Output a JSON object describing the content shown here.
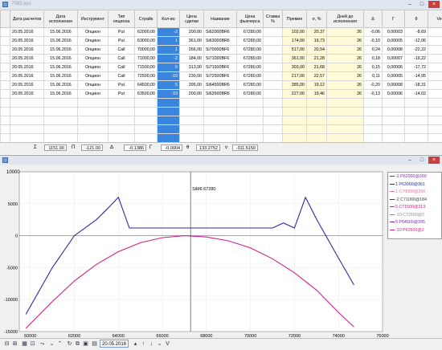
{
  "window_top": {
    "title": "7083.ops"
  },
  "columns": [
    "Дата расчетов",
    "Дата исполнения",
    "Инструмент",
    "Тип опциона",
    "Страйк",
    "Кол-во",
    "Цена сделки",
    "Название",
    "Цена фьючерса",
    "Ставка %",
    "Премия",
    "σ, %",
    "Дней до исполнения",
    "Δ",
    "Γ",
    "θ",
    "Vega"
  ],
  "rows": [
    [
      "20.05.2016",
      "15.06.2016",
      "Опцион",
      "Put",
      "62000,00",
      "-2",
      "200,00",
      "Si62000BR6",
      "67280,00",
      "",
      "102,00",
      "20,37",
      "26",
      "-0,06",
      "0,00003",
      "-8,69",
      "22,20"
    ],
    [
      "20.05.2016",
      "15.06.2016",
      "Опцион",
      "Put",
      "63000,00",
      "1",
      "361,00",
      "Si63000BR6",
      "67280,00",
      "",
      "174,00",
      "19,73",
      "26",
      "-0,10",
      "0,00005",
      "-12,06",
      "31,79"
    ],
    [
      "20.05.2016",
      "15.06.2016",
      "Опцион",
      "Call",
      "70000,00",
      "1",
      "266,00",
      "Si70000BF6",
      "67280,00",
      "",
      "517,00",
      "20,54",
      "26",
      "0,24",
      "0,00008",
      "-22,22",
      "56,25"
    ],
    [
      "20.05.2016",
      "15.06.2016",
      "Опцион",
      "Call",
      "71000,00",
      "-2",
      "184,00",
      "Si71000BF6",
      "67280,00",
      "",
      "361,00",
      "21,28",
      "26",
      "0,18",
      "0,00007",
      "-19,22",
      "46,96"
    ],
    [
      "20.05.2016",
      "15.06.2016",
      "Опцион",
      "Call",
      "71500,00",
      "5",
      "313,00",
      "Si71500BF6",
      "67280,00",
      "",
      "303,00",
      "21,68",
      "26",
      "0,15",
      "0,00006",
      "-17,72",
      "42,48"
    ],
    [
      "20.05.2016",
      "15.06.2016",
      "Опцион",
      "Call",
      "72500,00",
      "-10",
      "230,00",
      "Si72500BF6",
      "67280,00",
      "",
      "217,00",
      "22,57",
      "26",
      "0,11",
      "0,00005",
      "-14,95",
      "34,44"
    ],
    [
      "20.05.2016",
      "15.06.2016",
      "Опцион",
      "Put",
      "64500,00",
      "5",
      "395,00",
      "Si64500BR6",
      "67280,00",
      "",
      "385,00",
      "19,12",
      "26",
      "-0,20",
      "0,00008",
      "-18,31",
      "49,81"
    ],
    [
      "20.05.2016",
      "15.06.2016",
      "Опцион",
      "Put",
      "63500,00",
      "-10",
      "200,00",
      "Si63500BR6",
      "67280,00",
      "",
      "227,00",
      "19,46",
      "26",
      "-0,13",
      "0,00006",
      "-14,02",
      "37,45"
    ]
  ],
  "status": {
    "sigma_sym": "Σ",
    "sigma_val": "1151.00",
    "pi_sym": "Π",
    "pi_val": "-121.00",
    "delta_sym": "Δ",
    "delta_val": "-0.1386",
    "gamma_sym": "Γ",
    "gamma_val": "-0.0004",
    "theta_sym": "θ",
    "theta_val": "133.2752",
    "vega_sym": "ν",
    "vega_val": "-311.5150"
  },
  "chart_data": {
    "type": "line",
    "x_ticks": [
      "60000",
      "62000",
      "64000",
      "66000",
      "68000",
      "70000",
      "72000",
      "74000",
      "76000"
    ],
    "y_ticks": [
      "5000",
      "0",
      "-5000",
      "-10000",
      "-15000"
    ],
    "y_top_label": "10000",
    "xlim": [
      59500,
      76000
    ],
    "ylim": [
      -15000,
      10000
    ],
    "cursor_label": "SiM6 67280",
    "cursor_x": 67280,
    "series": [
      {
        "name": "expiration",
        "color": "#2a2aa0",
        "x": [
          59800,
          61000,
          62000,
          63000,
          63500,
          64000,
          64500,
          66000,
          68000,
          70000,
          71000,
          71500,
          72000,
          72500,
          73000,
          74000,
          74700
        ],
        "y": [
          -12300,
          -5000,
          0,
          2500,
          4200,
          6000,
          1200,
          1200,
          1200,
          1200,
          1200,
          2000,
          1200,
          6000,
          2600,
          -3500,
          -7700
        ]
      },
      {
        "name": "today",
        "color": "#d0208a",
        "x": [
          59800,
          61000,
          62000,
          63000,
          64000,
          65000,
          66000,
          67000,
          68000,
          69000,
          70000,
          71000,
          72000,
          73000,
          74000,
          74700
        ],
        "y": [
          -14500,
          -10300,
          -7100,
          -4500,
          -2500,
          -1100,
          -300,
          0,
          -200,
          -800,
          -1900,
          -3600,
          -5800,
          -8500,
          -12000,
          -14300
        ]
      }
    ]
  },
  "legend": [
    {
      "text": "-2 P62000@200",
      "color": "#7a2a9a"
    },
    {
      "text": "1 P63000@361",
      "color": "#2a2aa0"
    },
    {
      "text": "1 C70000@266",
      "color": "#e070a0"
    },
    {
      "text": "-2 C71000@184",
      "color": "#404040"
    },
    {
      "text": "5 C71500@313",
      "color": "#d0208a"
    },
    {
      "text": "-10 C72500@2",
      "color": "#909090"
    },
    {
      "text": "5 P64500@395",
      "color": "#7a2a9a"
    },
    {
      "text": "-10 P63500@2",
      "color": "#d0208a"
    }
  ],
  "toolbar": {
    "date_value": "20.05.2016"
  }
}
